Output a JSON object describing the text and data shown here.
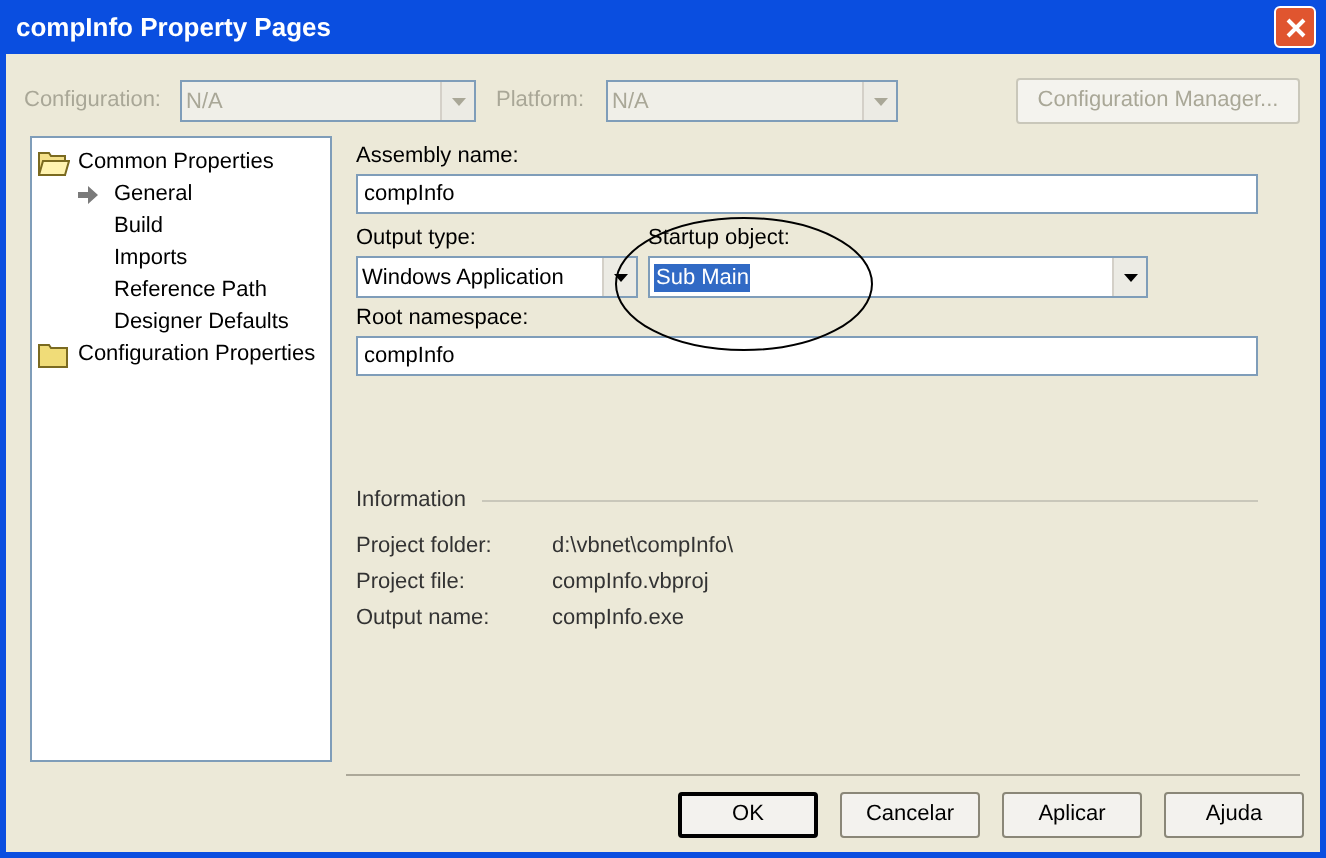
{
  "window": {
    "title": "compInfo Property Pages"
  },
  "config_bar": {
    "configuration": {
      "label": "Configuration:",
      "value": "N/A",
      "disabled": true
    },
    "platform": {
      "label": "Platform:",
      "value": "N/A",
      "disabled": true
    },
    "manager_button": {
      "label": "Configuration Manager...",
      "disabled": true
    }
  },
  "tree": [
    {
      "label": "Common Properties",
      "expanded": true,
      "children": [
        {
          "label": "General",
          "selected": true
        },
        {
          "label": "Build",
          "selected": false
        },
        {
          "label": "Imports",
          "selected": false
        },
        {
          "label": "Reference Path",
          "selected": false
        },
        {
          "label": "Designer Defaults",
          "selected": false
        }
      ]
    },
    {
      "label": "Configuration Properties",
      "expanded": false
    }
  ],
  "assembly_name": {
    "label": "Assembly name:",
    "value": "compInfo"
  },
  "output_type": {
    "label": "Output type:",
    "value": "Windows Application"
  },
  "startup_object": {
    "label": "Startup object:",
    "value": "Sub Main",
    "highlighted": true
  },
  "root_namespace": {
    "label": "Root namespace:",
    "value": "compInfo"
  },
  "information": {
    "title": "Information",
    "rows": [
      {
        "label": "Project folder:",
        "value": "d:\\vbnet\\compInfo\\"
      },
      {
        "label": "Project file:",
        "value": "compInfo.vbproj"
      },
      {
        "label": "Output name:",
        "value": "compInfo.exe"
      }
    ]
  },
  "buttons": [
    {
      "label": "OK",
      "default": true
    },
    {
      "label": "Cancelar",
      "default": false
    },
    {
      "label": "Aplicar",
      "default": false
    },
    {
      "label": "Ajuda",
      "default": false
    }
  ]
}
